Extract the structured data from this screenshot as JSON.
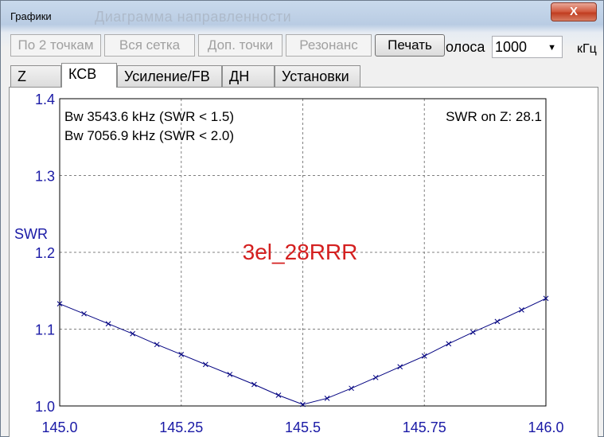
{
  "window": {
    "title": "Графики",
    "ghost_title": "Диаграмма направленности",
    "close_label": "X"
  },
  "toolbar": {
    "btn_two_points": "По 2 точкам",
    "btn_whole_grid": "Вся сетка",
    "btn_extra_points": "Доп. точки",
    "btn_resonance": "Резонанс",
    "btn_print": "Печать",
    "bandwidth_label": "олоса",
    "bandwidth_value": "1000",
    "bandwidth_unit": "кГц"
  },
  "tabs": [
    "Z",
    "КСВ",
    "Усиление/FB",
    "ДН",
    "Установки"
  ],
  "active_tab": "КСВ",
  "chart_data": {
    "type": "line",
    "ylabel": "SWR",
    "xlim": [
      145.0,
      146.0
    ],
    "ylim": [
      1.0,
      1.4
    ],
    "x_ticks": [
      "145.0",
      "145.25",
      "145.5",
      "145.75",
      "146.0"
    ],
    "y_ticks": [
      "1.4",
      "1.3",
      "1.2",
      "1.1",
      "1.0"
    ],
    "grid": true,
    "annotations": {
      "bw1": "Bw 3543.6 kHz (SWR < 1.5)",
      "bw2": "Bw 7056.9 kHz (SWR < 2.0)",
      "swr_on_z": "SWR on Z: 28.1",
      "model_name": "3el_28RRR"
    },
    "series": [
      {
        "color": "#000080",
        "points": [
          [
            145.0,
            1.133
          ],
          [
            145.05,
            1.12
          ],
          [
            145.1,
            1.107
          ],
          [
            145.15,
            1.094
          ],
          [
            145.2,
            1.08
          ],
          [
            145.25,
            1.067
          ],
          [
            145.3,
            1.054
          ],
          [
            145.35,
            1.041
          ],
          [
            145.4,
            1.028
          ],
          [
            145.45,
            1.014
          ],
          [
            145.5,
            1.002
          ],
          [
            145.55,
            1.01
          ],
          [
            145.6,
            1.023
          ],
          [
            145.65,
            1.037
          ],
          [
            145.7,
            1.051
          ],
          [
            145.75,
            1.065
          ],
          [
            145.8,
            1.081
          ],
          [
            145.85,
            1.096
          ],
          [
            145.9,
            1.11
          ],
          [
            145.95,
            1.125
          ],
          [
            146.0,
            1.14
          ]
        ]
      }
    ]
  }
}
